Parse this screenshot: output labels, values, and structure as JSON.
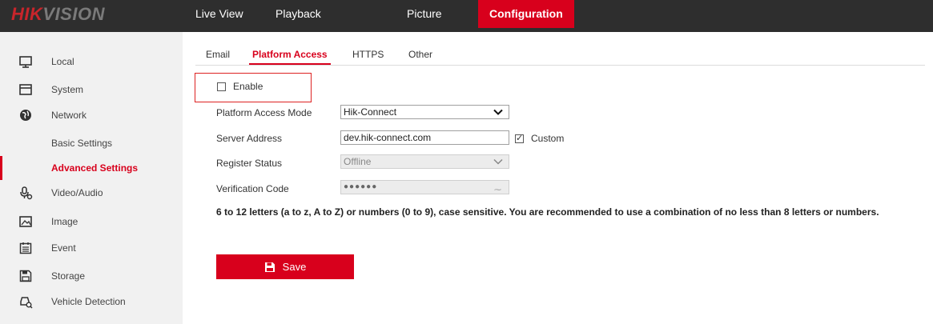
{
  "brand": {
    "logo_red": "HIK",
    "logo_gray": "VISION"
  },
  "nav": {
    "live_view": "Live View",
    "playback": "Playback",
    "picture": "Picture",
    "configuration": "Configuration"
  },
  "sidebar": {
    "local": "Local",
    "system": "System",
    "network": "Network",
    "basic_settings": "Basic Settings",
    "advanced_settings": "Advanced Settings",
    "video_audio": "Video/Audio",
    "image": "Image",
    "event": "Event",
    "storage": "Storage",
    "vehicle_detection": "Vehicle Detection"
  },
  "tabs": {
    "email": "Email",
    "platform_access": "Platform Access",
    "https": "HTTPS",
    "other": "Other"
  },
  "form": {
    "enable_label": "Enable",
    "enable_checked": false,
    "access_mode_label": "Platform Access Mode",
    "access_mode_value": "Hik-Connect",
    "server_address_label": "Server Address",
    "server_address_value": "dev.hik-connect.com",
    "custom_label": "Custom",
    "custom_checked": true,
    "register_status_label": "Register Status",
    "register_status_value": "Offline",
    "verification_code_label": "Verification Code",
    "verification_code_value": "●●●●●●",
    "hint": "6 to 12 letters (a to z, A to Z) or numbers (0 to 9), case sensitive. You are recommended to use a combination of no less than 8 letters or numbers."
  },
  "save_label": "Save",
  "colors": {
    "accent": "#d8001c",
    "topbar": "#2e2e2e",
    "sidebar": "#f1f1f1"
  }
}
